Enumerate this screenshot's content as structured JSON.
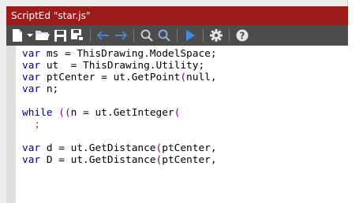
{
  "window": {
    "title": "ScriptEd \"star.js\""
  },
  "toolbar": {
    "buttons": [
      {
        "name": "new-file",
        "icon": "new-file-icon"
      },
      {
        "name": "dropdown",
        "icon": "chevron-down-icon"
      },
      {
        "name": "open",
        "icon": "open-folder-icon"
      },
      {
        "name": "save",
        "icon": "save-icon"
      },
      {
        "name": "save-as",
        "icon": "save-as-icon"
      },
      {
        "name": "back",
        "icon": "arrow-left-icon"
      },
      {
        "name": "forward",
        "icon": "arrow-right-icon"
      },
      {
        "name": "find",
        "icon": "search-icon"
      },
      {
        "name": "find-next",
        "icon": "search-next-icon"
      },
      {
        "name": "run",
        "icon": "play-icon"
      },
      {
        "name": "settings",
        "icon": "gear-icon"
      },
      {
        "name": "help",
        "icon": "help-icon"
      }
    ]
  },
  "editor": {
    "lines": [
      [
        {
          "t": "var",
          "c": "kw"
        },
        {
          "t": " ms = ThisDrawing.ModelSpace;"
        }
      ],
      [
        {
          "t": "var",
          "c": "kw"
        },
        {
          "t": " ut  = ThisDrawing.Utility;"
        }
      ],
      [
        {
          "t": "var",
          "c": "kw"
        },
        {
          "t": " ptCenter = ut.GetPoint"
        },
        {
          "t": "(",
          "c": "paren"
        },
        {
          "t": "null,"
        }
      ],
      [
        {
          "t": "var",
          "c": "kw"
        },
        {
          "t": " n;"
        }
      ],
      [],
      [
        {
          "t": "while ",
          "c": "kw"
        },
        {
          "t": "((",
          "c": "paren"
        },
        {
          "t": "n = ut.GetInteger"
        },
        {
          "t": "(",
          "c": "paren"
        }
      ],
      [
        {
          "t": "  "
        },
        {
          "t": ";",
          "c": "semi"
        }
      ],
      [],
      [
        {
          "t": "var",
          "c": "kw"
        },
        {
          "t": " d = ut.GetDistance"
        },
        {
          "t": "(",
          "c": "paren"
        },
        {
          "t": "ptCenter,"
        }
      ],
      [
        {
          "t": "var",
          "c": "kw"
        },
        {
          "t": " D = ut.GetDistance"
        },
        {
          "t": "(",
          "c": "paren"
        },
        {
          "t": "ptCenter,"
        }
      ]
    ]
  },
  "colors": {
    "title_bar": "#9e1b1b",
    "toolbar": "#4c4c4c",
    "keyword": "#000080",
    "paren": "#800080",
    "semicolon": "#c04000"
  }
}
